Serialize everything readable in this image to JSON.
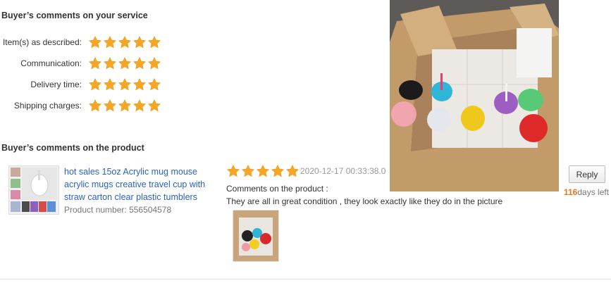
{
  "service_section": {
    "title": "Buyer’s comments on your service",
    "ratings": [
      {
        "label": "Item(s) as described:",
        "stars": 5
      },
      {
        "label": "Communication:",
        "stars": 5
      },
      {
        "label": "Delivery time:",
        "stars": 5
      },
      {
        "label": "Shipping charges:",
        "stars": 5
      }
    ]
  },
  "product_section": {
    "title": "Buyer’s comments on the product",
    "product": {
      "name": "hot sales 15oz Acrylic mug mouse acrylic mugs creative travel cup with straw carton clear plastic tumblers",
      "number_label": "Product number:",
      "number": "556504578"
    },
    "review": {
      "stars": 5,
      "date": "2020-12-17 00:33:38.0",
      "comment_label": "Comments on the product :",
      "comment": "They are all in great condition , they look exactly like they do in the picture",
      "reply_label": "Reply",
      "days_left_num": "116",
      "days_left_text": "days left"
    }
  },
  "colors": {
    "star": "#f5a623",
    "link": "#2a62c3",
    "days": "#e07a1f"
  },
  "icons": {
    "star": "star-icon"
  }
}
